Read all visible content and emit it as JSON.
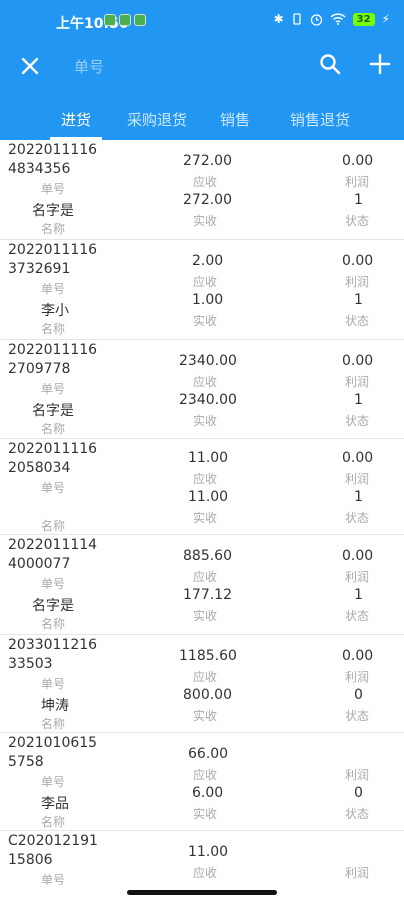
{
  "status_bar": {
    "time": "上午10:50",
    "battery": "32",
    "icons": [
      "bluetooth-icon",
      "vibrate-icon",
      "alarm-icon",
      "wifi-icon",
      "battery-icon",
      "charging-icon"
    ]
  },
  "header": {
    "close_icon": "close-icon",
    "search_placeholder": "单号",
    "search_icon": "search-icon",
    "add_icon": "plus-icon",
    "bg_color": "#2196F3"
  },
  "tabs": [
    {
      "label": "进货",
      "active": true
    },
    {
      "label": "采购退货",
      "active": false
    },
    {
      "label": "销售",
      "active": false
    },
    {
      "label": "销售退货",
      "active": false
    }
  ],
  "labels": {
    "id": "单号",
    "name": "名称",
    "receivable": "应收",
    "received": "实收",
    "profit": "利润",
    "status": "状态"
  },
  "records": [
    {
      "id1": "2022011116",
      "id2": "4834356",
      "name": "名字是",
      "receivable": "272.00",
      "received": "272.00",
      "profit": "0.00",
      "status": "1"
    },
    {
      "id1": "2022011116",
      "id2": "3732691",
      "name": "李小",
      "receivable": "2.00",
      "received": "1.00",
      "profit": "0.00",
      "status": "1"
    },
    {
      "id1": "2022011116",
      "id2": "2709778",
      "name": "名字是",
      "receivable": "2340.00",
      "received": "2340.00",
      "profit": "0.00",
      "status": "1"
    },
    {
      "id1": "2022011116",
      "id2": "2058034",
      "name": "",
      "receivable": "11.00",
      "received": "11.00",
      "profit": "0.00",
      "status": "1"
    },
    {
      "id1": "2022011114",
      "id2": "4000077",
      "name": "名字是",
      "receivable": "885.60",
      "received": "177.12",
      "profit": "0.00",
      "status": "1"
    },
    {
      "id1": "2033011216",
      "id2": "33503",
      "name": "坤涛",
      "receivable": "1185.60",
      "received": "800.00",
      "profit": "0.00",
      "status": "0"
    },
    {
      "id1": "2021010615",
      "id2": "5758",
      "name": "李品",
      "receivable": "66.00",
      "received": "6.00",
      "profit": "",
      "status": "0"
    },
    {
      "id1": "C202012191",
      "id2": "15806",
      "name": "",
      "receivable": "11.00",
      "received": "",
      "profit": "",
      "status": ""
    }
  ]
}
